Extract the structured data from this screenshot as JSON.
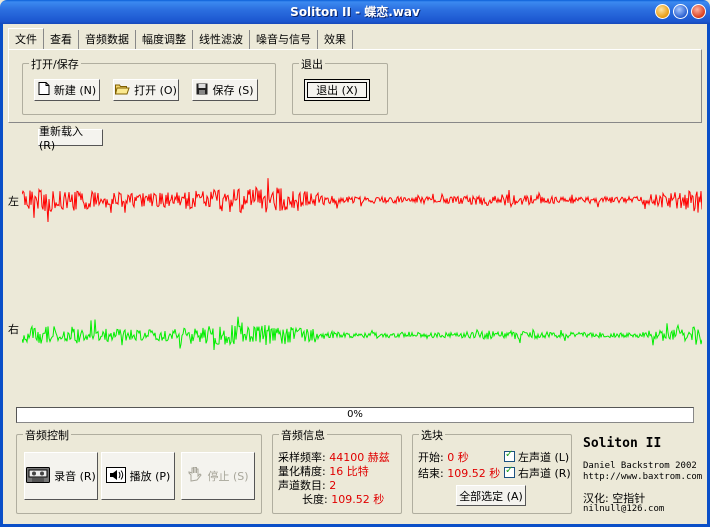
{
  "window": {
    "title": "Soliton II - 蝶恋.wav"
  },
  "tabs": [
    "文件",
    "查看",
    "音频数据",
    "幅度调整",
    "线性滤波",
    "噪音与信号",
    "效果"
  ],
  "file_group": {
    "title": "打开/保存",
    "new_label": "新建 (N)",
    "open_label": "打开 (O)",
    "save_label": "保存 (S)"
  },
  "exit_group": {
    "title": "退出",
    "exit_label": "退出 (X)"
  },
  "reload_label": "重新载入 (R)",
  "channels": {
    "left": "左",
    "right": "右",
    "left_color": "#ff0000",
    "right_color": "#00ee00"
  },
  "progress": {
    "value": 0,
    "text": "0%"
  },
  "audio_control": {
    "title": "音频控制",
    "record_label": "录音 (R)",
    "play_label": "播放 (P)",
    "stop_label": "停止 (S)"
  },
  "audio_info": {
    "title": "音频信息",
    "rate_label": "采样频率:",
    "rate_value": "44100 赫兹",
    "depth_label": "量化精度:",
    "depth_value": "16 比特",
    "channels_label": "声道数目:",
    "channels_value": "2",
    "length_label": "长度:",
    "length_value": "109.52 秒"
  },
  "selection": {
    "title": "选块",
    "start_label": "开始:",
    "start_value": "0 秒",
    "end_label": "结束:",
    "end_value": "109.52 秒",
    "left_channel_label": "左声道 (L)",
    "right_channel_label": "右声道 (R)",
    "select_all_label": "全部选定 (A)"
  },
  "about": {
    "app_name": "Soliton II",
    "author": "Daniel Backstrom 2002",
    "url": "http://www.baxtrom.com",
    "translator": "汉化: 空指针",
    "email": "nilnull@126.com"
  }
}
